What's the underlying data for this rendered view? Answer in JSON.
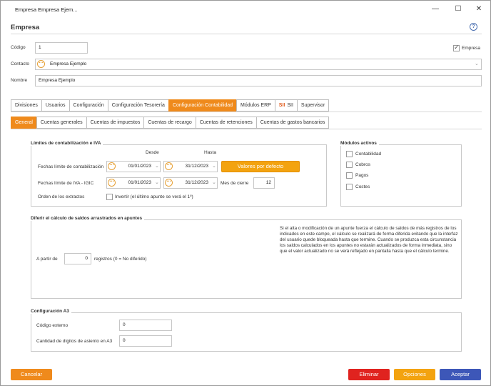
{
  "window": {
    "title": "Empresa Empresa Ejem...",
    "minimize": "—",
    "maximize": "☐",
    "close": "✕"
  },
  "header": {
    "title": "Empresa",
    "help": "?"
  },
  "fields": {
    "codigo_label": "Código",
    "codigo_value": "1",
    "empresa_check_label": "Empresa",
    "empresa_checked": true,
    "contacto_label": "Contacto",
    "contacto_value": "Empresa Ejemplo",
    "nombre_label": "Nombre",
    "nombre_value": "Empresa Ejemplo"
  },
  "main_tabs": [
    {
      "label": "Divisiones"
    },
    {
      "label": "Usuarios"
    },
    {
      "label": "Configuración"
    },
    {
      "label": "Configuración Tesorería"
    },
    {
      "label": "Configuración Contabilidad",
      "active": true
    },
    {
      "label": "Módulos ERP"
    },
    {
      "label": "SII",
      "badge": "SII"
    },
    {
      "label": "Supervisor"
    }
  ],
  "sub_tabs": [
    {
      "label": "General",
      "active": true
    },
    {
      "label": "Cuentas generales"
    },
    {
      "label": "Cuentas de impuestos"
    },
    {
      "label": "Cuentas de recargo"
    },
    {
      "label": "Cuentas de retenciones"
    },
    {
      "label": "Cuentas de gastos bancarios"
    }
  ],
  "limites": {
    "title": "Límites de contabilización e IVA",
    "desde": "Desde",
    "hasta": "Hasta",
    "fechas_contab_label": "Fechas límite de contabilización",
    "contab_desde": "01/01/2023",
    "contab_hasta": "31/12/2023",
    "valores_btn": "Valores por defecto",
    "fechas_iva_label": "Fechas límite de IVA - IGIC",
    "iva_desde": "01/01/2023",
    "iva_hasta": "31/12/2023",
    "mes_cierre_label": "Mes de cierre",
    "mes_cierre_value": "12",
    "orden_label": "Orden de los extractos",
    "invertir_label": "Invertir (el último apunte se verá el 1º)",
    "invertir_checked": false
  },
  "modulos": {
    "title": "Módulos activos",
    "items": [
      {
        "label": "Contabilidad",
        "checked": false
      },
      {
        "label": "Cobros",
        "checked": false
      },
      {
        "label": "Pagos",
        "checked": false
      },
      {
        "label": "Costes",
        "checked": false
      }
    ]
  },
  "diferir": {
    "title": "Diferir el cálculo de saldos arrastrados en apuntes",
    "a_partir_label": "A partir de",
    "registros_value": "0",
    "registros_label": "registros (0 = No diferido)",
    "info": "Si el alta o modificación de un apunte fuerza el cálculo de saldos de más registros de los indicados en este campo, el cálculo se realizará de forma diferida evitando que la interfaz del usuario quede bloqueada hasta que termine. Cuando se produzca esta circunstancia los saldos calculados en los apuntes no estarán actualizados de forma inmediata, sino que el valor actualizado no se verá reflejado en pantalla hasta que el cálculo termine."
  },
  "a3": {
    "title": "Configuración A3",
    "codigo_externo_label": "Código externo",
    "codigo_externo_value": "0",
    "digitos_label": "Cantidad de dígitos de asiento en A3",
    "digitos_value": "0"
  },
  "footer": {
    "cancelar": "Cancelar",
    "eliminar": "Eliminar",
    "opciones": "Opciones",
    "aceptar": "Aceptar"
  },
  "colors": {
    "accent_orange": "#ef8a1c",
    "button_yellow": "#f3a310",
    "delete_red": "#e0231f",
    "accept_blue": "#3d57b8"
  }
}
